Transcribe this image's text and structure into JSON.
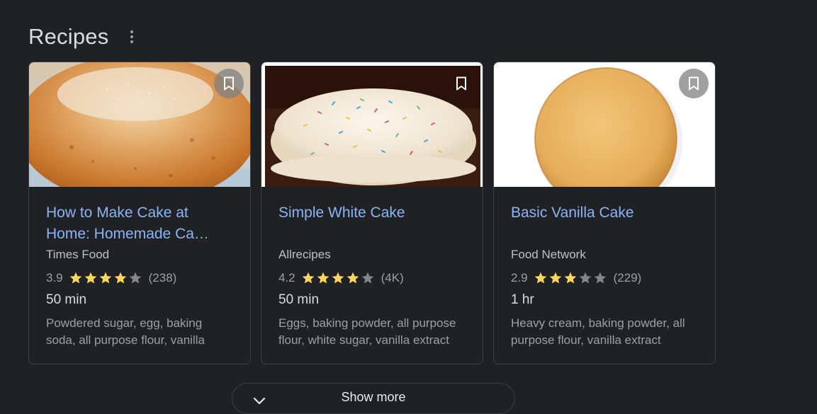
{
  "section": {
    "title": "Recipes"
  },
  "colors": {
    "link": "#8ab4f8",
    "star_filled": "#fdd663",
    "star_empty": "#80868b",
    "background": "#202124"
  },
  "cards": [
    {
      "title": "How to Make Cake at Home: Homemade Ca…",
      "source": "Times Food",
      "rating": "3.9",
      "stars_filled": 4,
      "reviews": "(238)",
      "time": "50 min",
      "ingredients": "Powdered sugar, egg, baking soda, all purpose flour, vanilla",
      "image_icon": "sponge-cake-photo",
      "bookmark_icon": "bookmark-icon"
    },
    {
      "title": "Simple White Cake",
      "source": "Allrecipes",
      "rating": "4.2",
      "stars_filled": 4,
      "reviews": "(4K)",
      "time": "50 min",
      "ingredients": "Eggs, baking powder, all purpose flour, white sugar, vanilla extract",
      "image_icon": "frosted-sprinkle-cake-photo",
      "bookmark_icon": "bookmark-icon"
    },
    {
      "title": "Basic Vanilla Cake",
      "source": "Food Network",
      "rating": "2.9",
      "stars_filled": 3,
      "reviews": "(229)",
      "time": "1 hr",
      "ingredients": "Heavy cream, baking powder, all purpose flour, vanilla extract",
      "image_icon": "vanilla-cake-round-photo",
      "bookmark_icon": "bookmark-icon"
    }
  ],
  "show_more": {
    "label": "Show more",
    "icon": "chevron-down-icon"
  }
}
